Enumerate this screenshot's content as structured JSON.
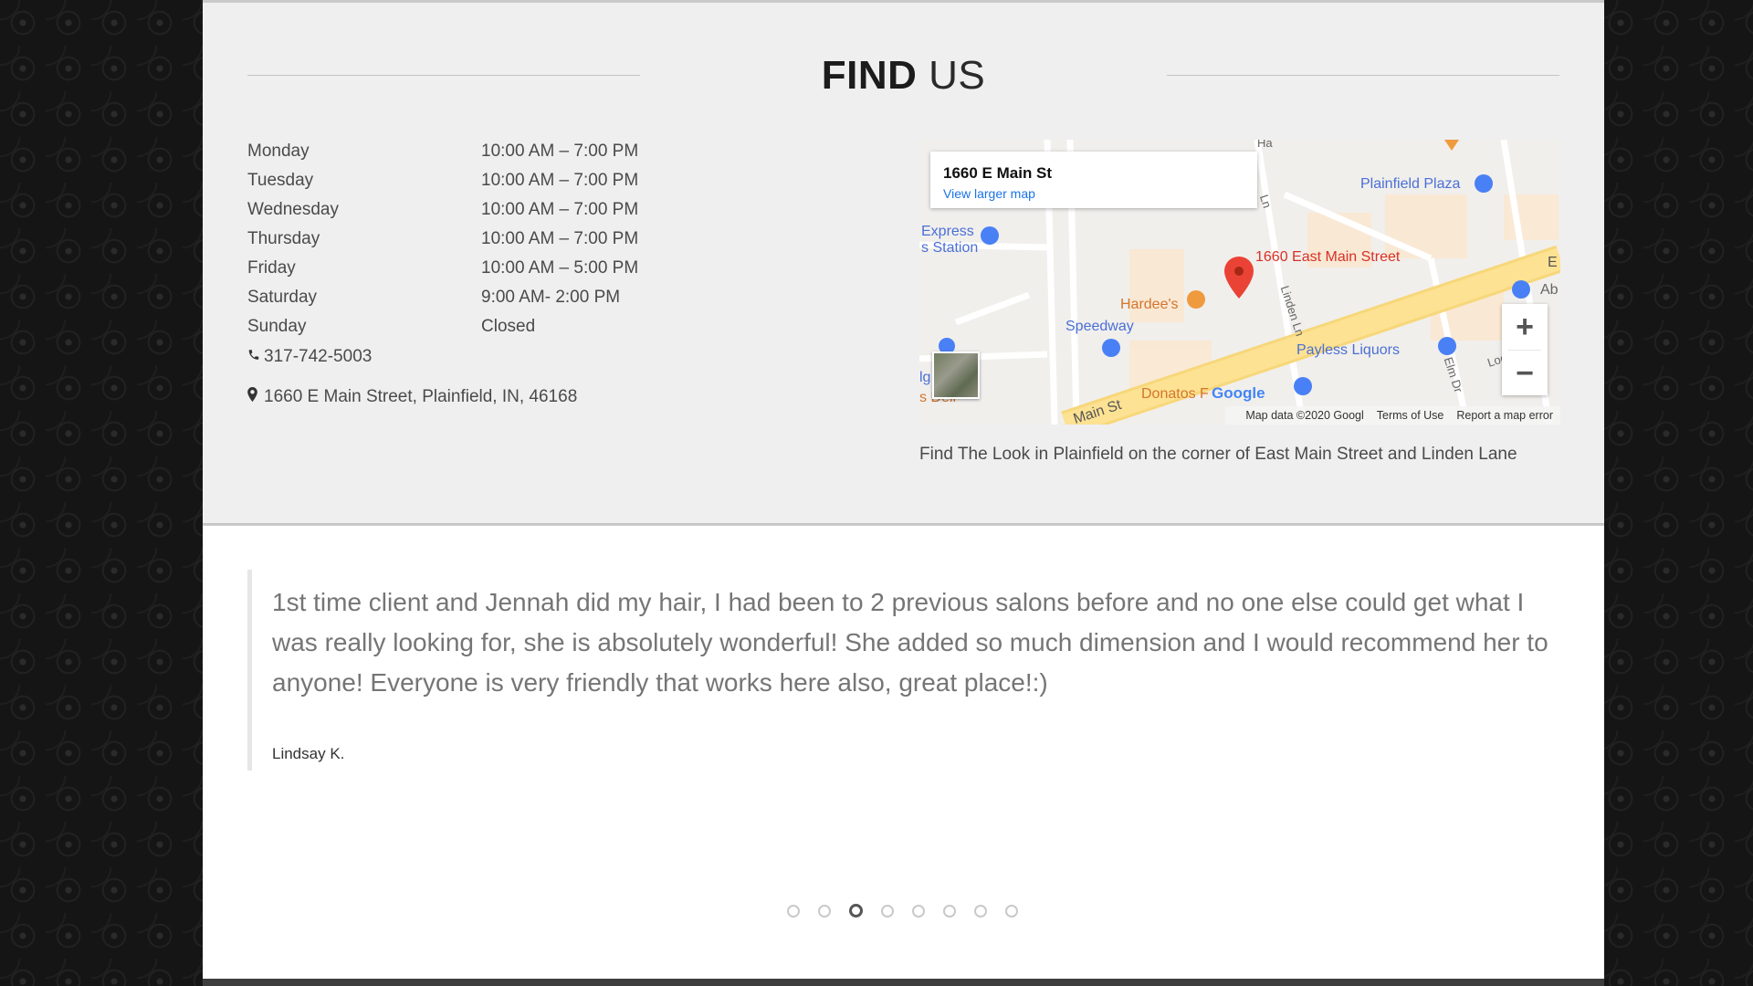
{
  "find_us": {
    "title_bold": "FIND",
    "title_light": "US",
    "hours": [
      {
        "day": "Monday",
        "time": "10:00 AM – 7:00 PM"
      },
      {
        "day": "Tuesday",
        "time": "10:00 AM – 7:00 PM"
      },
      {
        "day": "Wednesday",
        "time": "10:00 AM – 7:00 PM"
      },
      {
        "day": "Thursday",
        "time": "10:00 AM – 7:00 PM"
      },
      {
        "day": "Friday",
        "time": "10:00 AM – 5:00 PM"
      },
      {
        "day": "Saturday",
        "time": "9:00 AM- 2:00 PM"
      },
      {
        "day": "Sunday",
        "time": "Closed"
      }
    ],
    "phone": "317-742-5003",
    "address": "1660 E Main Street, Plainfield, IN, 46168",
    "phone_icon": "phone-icon",
    "address_icon": "map-marker-icon"
  },
  "map": {
    "card_address": "1660 E Main St",
    "card_link": "View larger map",
    "pin_label": "1660 East Main Street",
    "places": {
      "plainfield_plaza": "Plainfield Plaza",
      "express_station": "Express\ns Station",
      "hardees": "Hardee's",
      "speedway": "Speedway",
      "payless": "Payless Liquors",
      "donatos": "Donatos F",
      "main_st": "Main St",
      "linden_ln": "Linden Ln",
      "elm_dr": "Elm Dr",
      "ab": "Ab",
      "e": "E",
      "ha": "Ha",
      "loc": "Loc",
      "lg": "lg",
      "s_deli": "s Deli",
      "ln": "Ln"
    },
    "google": "Google",
    "footer_data": "Map data ©2020 Googl",
    "footer_terms": "Terms of Use",
    "footer_report": "Report a map error",
    "zoom_in": "+",
    "zoom_out": "−",
    "caption": "Find The Look in Plainfield on the corner of East Main Street and Linden Lane",
    "colors": {
      "pin": "#ea4335",
      "poi_blue": "#4a80f5",
      "poi_orange": "#f09a3e",
      "road_yellow": "#fde293"
    }
  },
  "testimonial": {
    "quote": "1st time client and Jennah did my hair, I had been to 2 previous salons before and no one else could get what I was really looking for, she is absolutely wonderful! She added so much dimension and I would recommend her to anyone! Everyone is very friendly that works here also, great place!:)",
    "author": "Lindsay K.",
    "carousel_count": 8,
    "carousel_active": 3
  }
}
